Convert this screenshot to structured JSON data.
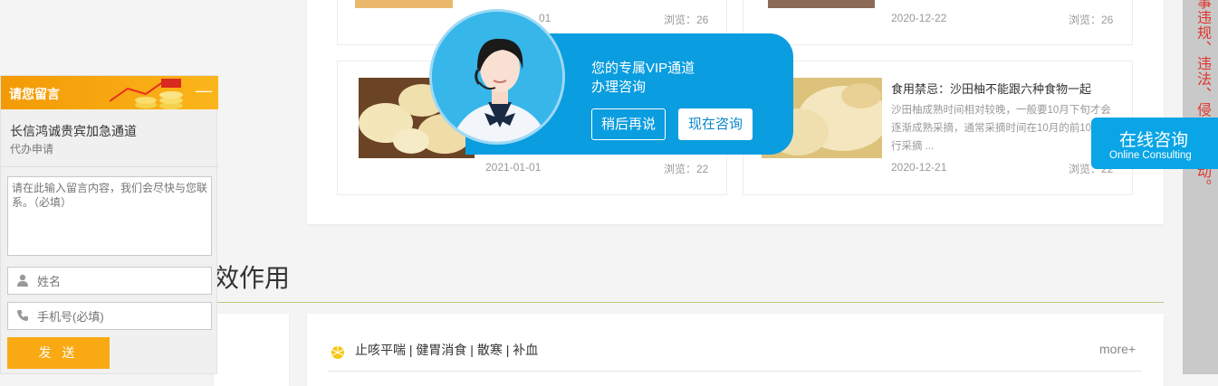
{
  "articles": [
    {
      "date": "01",
      "views": "浏览：26"
    },
    {
      "date": "2020-12-22",
      "views": "浏览：26"
    },
    {
      "date": "2021-01-01",
      "views": "浏览：22"
    },
    {
      "title": "食用禁忌：沙田柚不能跟六种食物一起",
      "excerpt": "沙田柚成熟时间相对较晚，一般要10月下旬才会逐渐成熟采摘，通常采摘时间在10月的前10天进行采摘 ...",
      "date": "2020-12-21",
      "views": "浏览：22"
    }
  ],
  "section": {
    "title_fragment": "效作用"
  },
  "message_widget": {
    "header": "请您留言",
    "minimize": "—",
    "company": "长信鸿诚贵宾加急通道",
    "subtitle": "代办申请",
    "textarea_placeholder": "请在此输入留言内容，我们会尽快与您联系。（必填）",
    "name_placeholder": "姓名",
    "phone_placeholder": "手机号(必填)",
    "send_label": "发 送"
  },
  "vip_popup": {
    "title_line1": "您的专属VIP通道",
    "title_line2": "办理咨询",
    "later_label": "稍后再说",
    "now_label": "现在咨询"
  },
  "online_consult": {
    "cn": "在线咨询",
    "en": "Online Consulting"
  },
  "right_strip_text": "事违规、违法、侵权等活动。",
  "bottom_panel": {
    "tags": "止咳平喘 | 健胃消食 | 散寒 | 补血",
    "more": "more+"
  },
  "colors": {
    "accent_blue": "#0a9ddf",
    "orange": "#f9a912",
    "strip_red": "#e0352c"
  }
}
